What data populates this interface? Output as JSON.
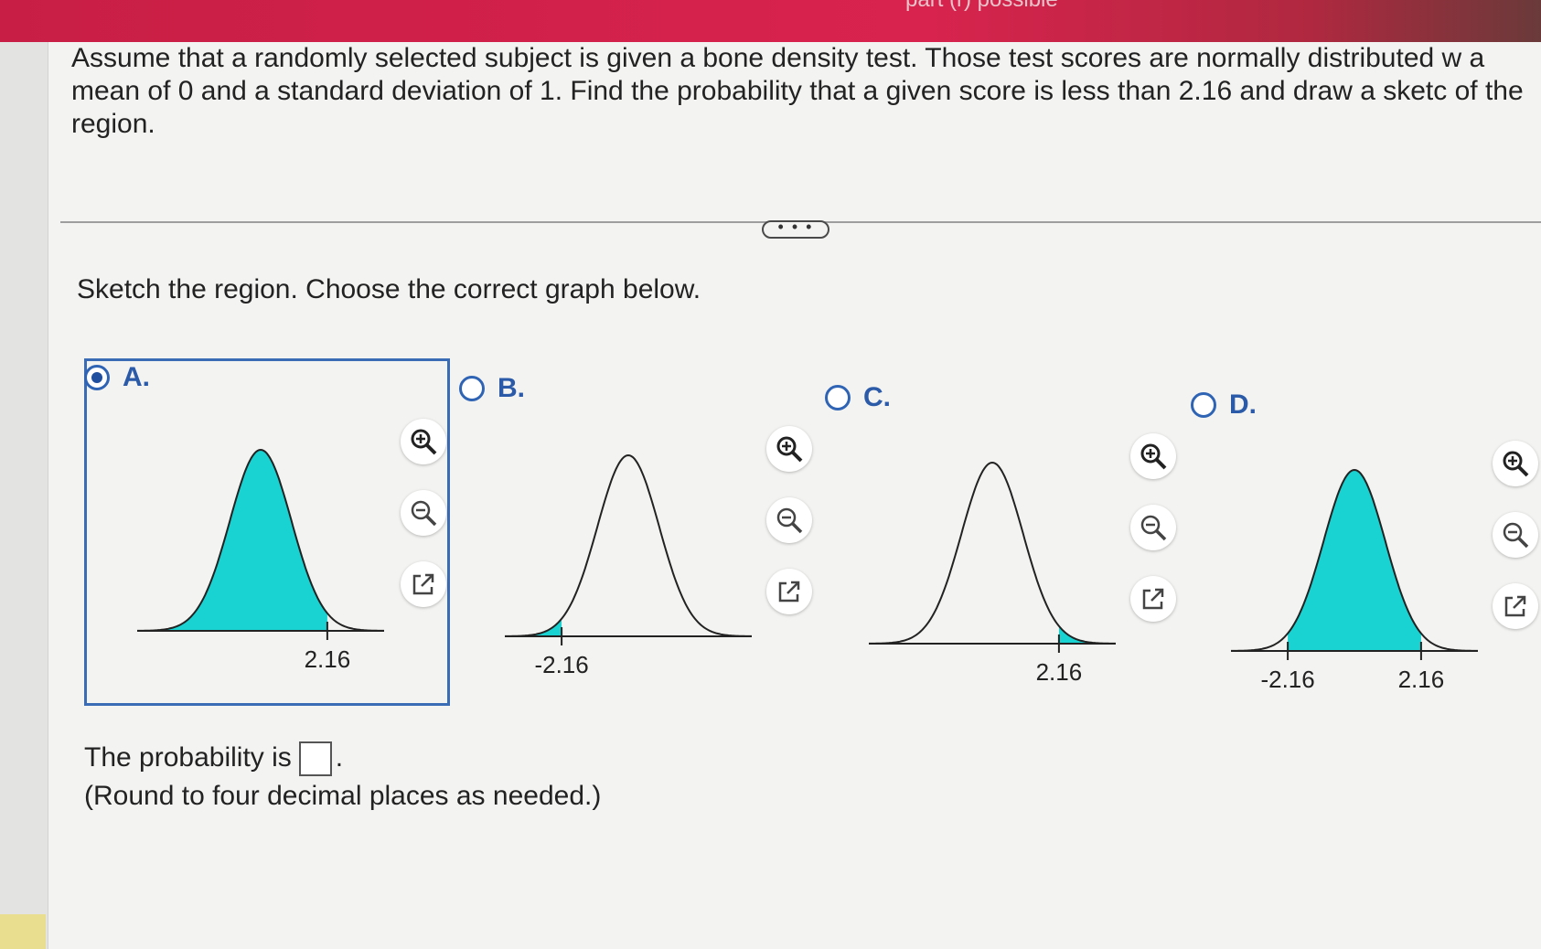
{
  "header": {
    "partial_text": "part (r) possible"
  },
  "question": {
    "text": "Assume that a randomly selected subject is given a bone density test. Those test scores are normally distributed w a mean of 0 and a standard deviation of 1. Find the probability that a given score is less than 2.16 and draw a sketc of the region.",
    "more_button": "• • •",
    "prompt": "Sketch the region. Choose the correct graph below."
  },
  "options": [
    {
      "label": "A.",
      "selected": true,
      "shaded": "left of 2.16",
      "ticks": [
        "2.16"
      ]
    },
    {
      "label": "B.",
      "selected": false,
      "shaded": "left of -2.16",
      "ticks": [
        "-2.16"
      ]
    },
    {
      "label": "C.",
      "selected": false,
      "shaded": "right of 2.16",
      "ticks": [
        "2.16"
      ]
    },
    {
      "label": "D.",
      "selected": false,
      "shaded": "between -2.16 and 2.16",
      "ticks": [
        "-2.16",
        "2.16"
      ]
    }
  ],
  "tools": {
    "zoom_in": "zoom-in-icon",
    "zoom_out": "zoom-out-icon",
    "popout": "popout-icon"
  },
  "answer": {
    "prefix": "The probability is",
    "suffix": ".",
    "value": "",
    "note": "(Round to four decimal places as needed.)"
  },
  "colors": {
    "shade": "#19d3d3",
    "accent": "#2f64b5",
    "header": "#d8234e"
  }
}
